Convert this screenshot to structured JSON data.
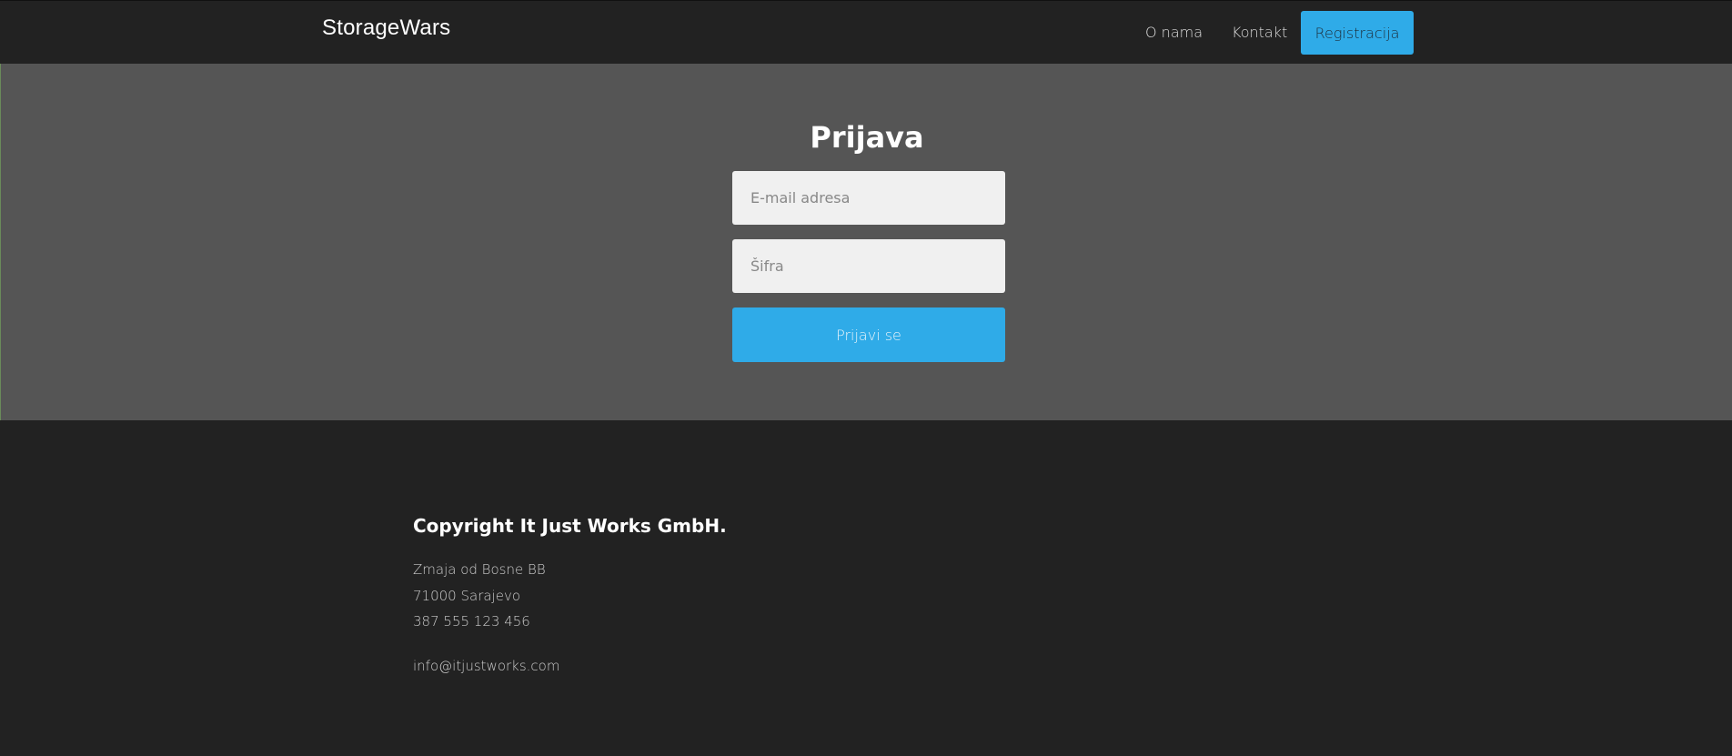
{
  "navbar": {
    "brand": "StorageWars",
    "links": [
      {
        "label": "O nama"
      },
      {
        "label": "Kontakt"
      }
    ],
    "register_label": "Registracija"
  },
  "login": {
    "title": "Prijava",
    "email_placeholder": "E-mail adresa",
    "email_value": "",
    "password_placeholder": "Šifra",
    "password_value": "",
    "submit_label": "Prijavi se"
  },
  "footer": {
    "copyright": "Copyright It Just Works GmbH.",
    "street": "Zmaja od Bosne BB",
    "city": "71000 Sarajevo",
    "phone": "387 555 123 456",
    "email": "info@itjustworks.com"
  },
  "colors": {
    "accent": "#2fabe8",
    "navbar_bg": "#222222",
    "login_bg": "#555555",
    "footer_bg": "#222222"
  }
}
